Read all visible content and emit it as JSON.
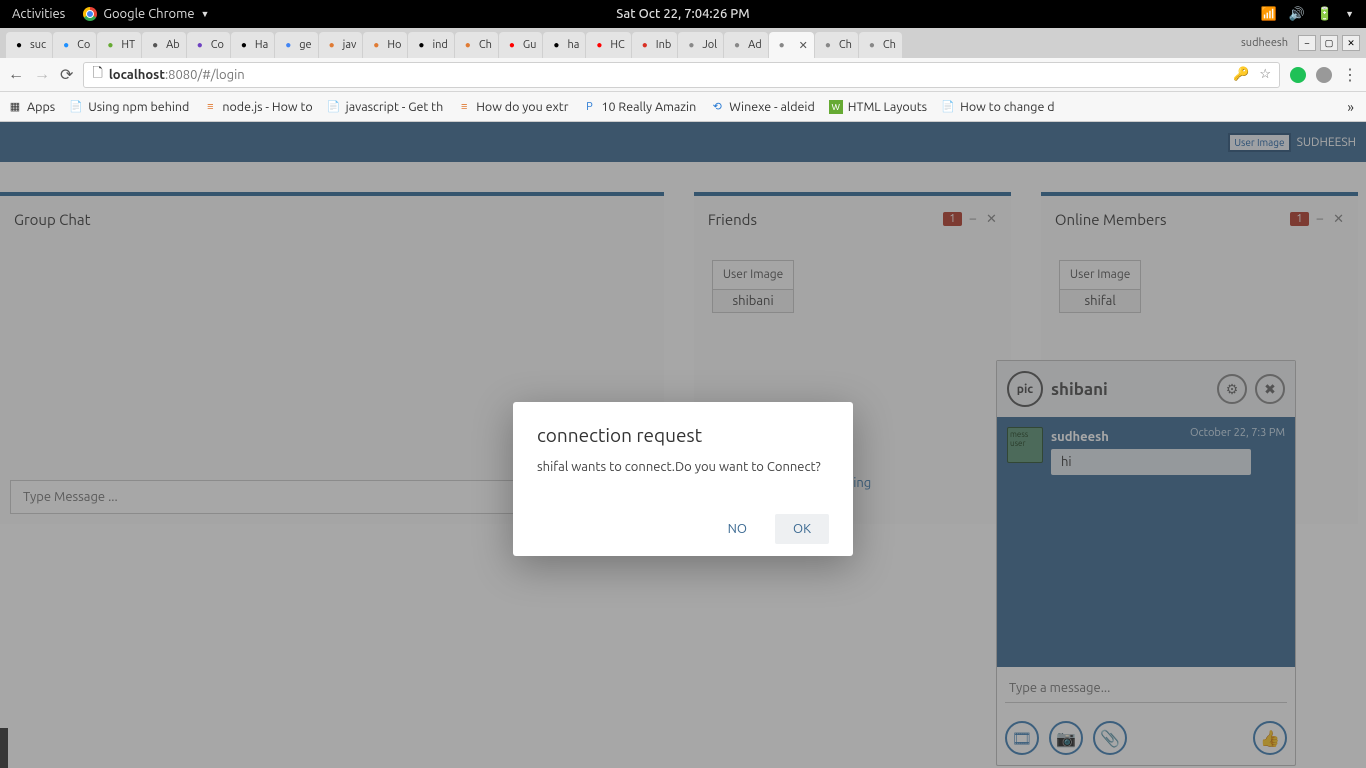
{
  "gnome": {
    "activities": "Activities",
    "appname": "Google Chrome",
    "datetime": "Sat Oct 22,  7:04:26 PM"
  },
  "tabs": [
    {
      "label": "suc"
    },
    {
      "label": "Co"
    },
    {
      "label": "HT"
    },
    {
      "label": "Ab"
    },
    {
      "label": "Co"
    },
    {
      "label": "Ha"
    },
    {
      "label": "ge"
    },
    {
      "label": "jav"
    },
    {
      "label": "Ho"
    },
    {
      "label": "ind"
    },
    {
      "label": "Ch"
    },
    {
      "label": "Gu"
    },
    {
      "label": "ha"
    },
    {
      "label": "HC"
    },
    {
      "label": "Inb"
    },
    {
      "label": "Jol"
    },
    {
      "label": "Ad"
    },
    {
      "label": "",
      "active": true
    },
    {
      "label": "Ch"
    },
    {
      "label": "Ch"
    }
  ],
  "chrome_user": "sudheesh",
  "url": {
    "host": "localhost",
    "port": ":8080",
    "path": "/#/login"
  },
  "bookmarks": [
    "Apps",
    "Using npm behind",
    "node.js - How to",
    "javascript - Get th",
    "How do you extr",
    "10 Really Amazin",
    "Winexe - aldeid",
    "HTML Layouts",
    "How to change d"
  ],
  "app_user": "SUDHEESH",
  "user_image_alt": "User Image",
  "panels": {
    "group": {
      "title": "Group Chat",
      "placeholder": "Type Message ...",
      "hint": "ething"
    },
    "friends": {
      "title": "Friends",
      "badge": "1",
      "user_img": "User\nImage",
      "user_name": "shibani"
    },
    "online": {
      "title": "Online Members",
      "badge": "1",
      "user_img": "User\nImage",
      "user_name": "shifal"
    }
  },
  "chat": {
    "pic_label": "pic",
    "name": "shibani",
    "msg_user": "sudheesh",
    "msg_time": "October 22, 7:3 PM",
    "msg_text": "hi",
    "avatar_alt": "mess user",
    "input_placeholder": "Type a message..."
  },
  "modal": {
    "title": "connection request",
    "body": "shifal wants to connect.Do you want to Connect?",
    "no": "NO",
    "ok": "OK"
  }
}
